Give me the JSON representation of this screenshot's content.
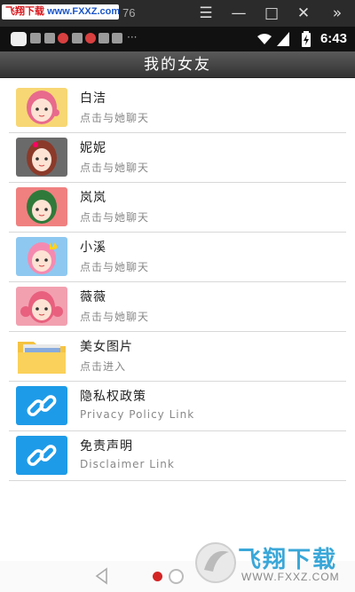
{
  "emulator": {
    "watermark_brand": "飞翔下载",
    "watermark_site": "www.FXXZ.com",
    "window_number": "76"
  },
  "status_bar": {
    "time": "6:43",
    "overflow_glyph": "···"
  },
  "header": {
    "title": "我的女友"
  },
  "list": {
    "items": [
      {
        "name": "白洁",
        "subtitle": "点击与她聊天",
        "icon": "girl-avatar-pink-hair"
      },
      {
        "name": "妮妮",
        "subtitle": "点击与她聊天",
        "icon": "girl-avatar-dark-hair"
      },
      {
        "name": "岚岚",
        "subtitle": "点击与她聊天",
        "icon": "girl-avatar-green-hair"
      },
      {
        "name": "小溪",
        "subtitle": "点击与她聊天",
        "icon": "girl-avatar-crown"
      },
      {
        "name": "薇薇",
        "subtitle": "点击与她聊天",
        "icon": "girl-avatar-pink-pigtails"
      },
      {
        "name": "美女图片",
        "subtitle": "点击进入",
        "icon": "folder-icon"
      },
      {
        "name": "隐私权政策",
        "subtitle": "Privacy Policy Link",
        "icon": "link-icon"
      },
      {
        "name": "免责声明",
        "subtitle": "Disclaimer Link",
        "icon": "link-icon"
      }
    ]
  },
  "pager": {
    "current_page": 1,
    "total_pages": 2
  },
  "watermark": {
    "brand": "飞翔下载",
    "url": "WWW.FXXZ.COM"
  },
  "colors": {
    "link_tile": "#1e9be8",
    "folder": "#f5c342",
    "active_dot": "#d42424",
    "title_bar": "#444444"
  }
}
